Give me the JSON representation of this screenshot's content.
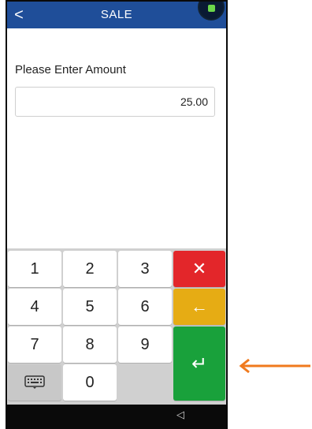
{
  "header": {
    "back_icon": "chevron-left-icon",
    "back_glyph": "<",
    "title": "SALE"
  },
  "prompt": {
    "label": "Please Enter Amount"
  },
  "amount": {
    "value": "25.00"
  },
  "keypad": {
    "digits": [
      "1",
      "2",
      "3",
      "4",
      "5",
      "6",
      "7",
      "8",
      "9",
      "0"
    ],
    "cancel_glyph": "✕",
    "backspace_glyph": "←",
    "enter_glyph": "↵",
    "keyboard_icon": "keyboard-icon"
  },
  "navbar": {
    "back_glyph": "◁"
  },
  "annotation": {
    "arrow_color": "#f07a1e"
  },
  "colors": {
    "header_bg": "#1f4e99",
    "cancel": "#e3262a",
    "backspace": "#e6ac14",
    "enter": "#19a13b"
  }
}
